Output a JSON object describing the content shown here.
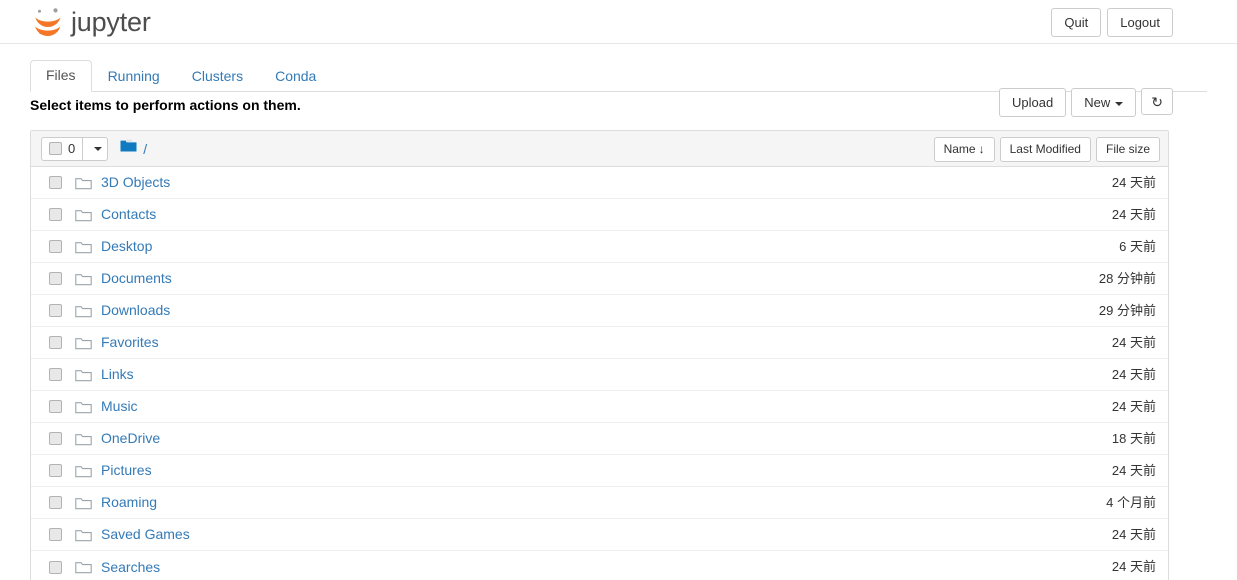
{
  "header": {
    "brand": "jupyter",
    "logo_icon": "jupyter-logo",
    "quit_label": "Quit",
    "logout_label": "Logout"
  },
  "tabs": [
    {
      "label": "Files",
      "active": true
    },
    {
      "label": "Running",
      "active": false
    },
    {
      "label": "Clusters",
      "active": false
    },
    {
      "label": "Conda",
      "active": false
    }
  ],
  "notice": {
    "text": "Select items to perform actions on them.",
    "upload_label": "Upload",
    "new_label": "New",
    "new_caret_icon": "chevron-down-icon",
    "refresh_icon": "refresh-icon",
    "refresh_glyph": "↻"
  },
  "list_toolbar": {
    "select_all_checkbox": "select-all-checkbox",
    "selected_count": "0",
    "select_dropdown_icon": "chevron-down-icon",
    "breadcrumb_folder_icon": "folder-icon",
    "breadcrumb_path": "/",
    "sort": {
      "name_label": "Name",
      "name_sort_arrow": "↓",
      "last_modified_label": "Last Modified",
      "file_size_label": "File size"
    }
  },
  "colors": {
    "link": "#337ab7",
    "brand_orange": "#f37726",
    "brand_gray": "#4d4d4d",
    "folder_blue": "#0f7ac0",
    "border": "#dddddd",
    "toolbar_bg": "#f5f5f5"
  },
  "files": [
    {
      "name": "3D Objects",
      "icon": "folder-icon",
      "modified": "24 天前",
      "size": ""
    },
    {
      "name": "Contacts",
      "icon": "folder-icon",
      "modified": "24 天前",
      "size": ""
    },
    {
      "name": "Desktop",
      "icon": "folder-icon",
      "modified": "6 天前",
      "size": ""
    },
    {
      "name": "Documents",
      "icon": "folder-icon",
      "modified": "28 分钟前",
      "size": ""
    },
    {
      "name": "Downloads",
      "icon": "folder-icon",
      "modified": "29 分钟前",
      "size": ""
    },
    {
      "name": "Favorites",
      "icon": "folder-icon",
      "modified": "24 天前",
      "size": ""
    },
    {
      "name": "Links",
      "icon": "folder-icon",
      "modified": "24 天前",
      "size": ""
    },
    {
      "name": "Music",
      "icon": "folder-icon",
      "modified": "24 天前",
      "size": ""
    },
    {
      "name": "OneDrive",
      "icon": "folder-icon",
      "modified": "18 天前",
      "size": ""
    },
    {
      "name": "Pictures",
      "icon": "folder-icon",
      "modified": "24 天前",
      "size": ""
    },
    {
      "name": "Roaming",
      "icon": "folder-icon",
      "modified": "4 个月前",
      "size": ""
    },
    {
      "name": "Saved Games",
      "icon": "folder-icon",
      "modified": "24 天前",
      "size": ""
    },
    {
      "name": "Searches",
      "icon": "folder-icon",
      "modified": "24 天前",
      "size": ""
    }
  ]
}
